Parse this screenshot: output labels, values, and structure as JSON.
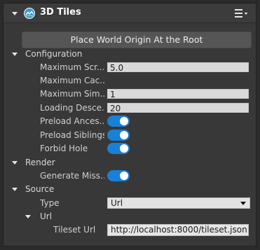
{
  "panel": {
    "title": "3D Tiles",
    "logo_icon": "cesium-logo-icon",
    "menu_icon": "hamburger-menu-icon",
    "accent_color": "#1a7fd6"
  },
  "actions": {
    "place_origin_label": "Place World Origin At the Root"
  },
  "configuration": {
    "label": "Configuration",
    "max_screen_label": "Maximum Scr...",
    "max_screen_value": "5.0",
    "max_cache_label": "Maximum Cac...",
    "max_sim_label": "Maximum Sim...",
    "max_sim_value": "1",
    "loading_desc_label": "Loading Desce...",
    "loading_desc_value": "20",
    "preload_ancestors_label": "Preload Ances...",
    "preload_ancestors_on": true,
    "preload_siblings_label": "Preload Siblings",
    "preload_siblings_on": true,
    "forbid_holes_label": "Forbid Hole",
    "forbid_holes_on": true
  },
  "render": {
    "label": "Render",
    "generate_missing_label": "Generate Miss...",
    "generate_missing_on": true
  },
  "source": {
    "label": "Source",
    "type_label": "Type",
    "type_value": "Url",
    "url_group_label": "Url",
    "tileset_url_label": "Tileset Url",
    "tileset_url_value": "http://localhost:8000/tileset.json"
  }
}
